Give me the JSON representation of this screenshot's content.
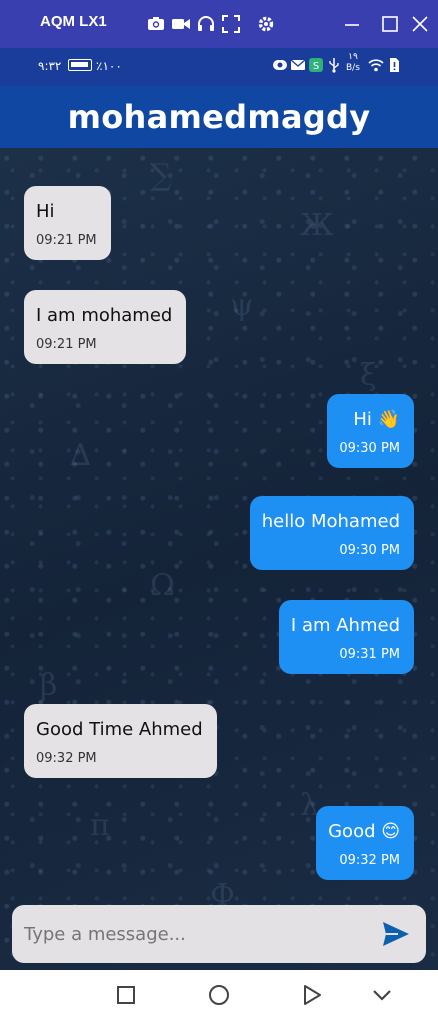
{
  "window": {
    "title": "AQM LX1",
    "icons": [
      "camera-icon",
      "video-icon",
      "headset-icon",
      "fullscreen-icon",
      "gear-icon"
    ],
    "controls": [
      "minimize-icon",
      "maximize-icon",
      "close-icon"
    ]
  },
  "status_bar": {
    "time": "٩:٣٢",
    "battery_pct": "٪١٠٠",
    "net_speed_value": "١٩",
    "net_speed_unit": "B/s"
  },
  "app_bar": {
    "title": "mohamedmagdy"
  },
  "messages": [
    {
      "direction": "received",
      "text": "Hi",
      "time": "09:21 PM"
    },
    {
      "direction": "received",
      "text": "I am mohamed",
      "time": "09:21 PM"
    },
    {
      "direction": "sent",
      "text": "Hi 👋",
      "time": "09:30 PM"
    },
    {
      "direction": "sent",
      "text": "hello Mohamed",
      "time": "09:30 PM"
    },
    {
      "direction": "sent",
      "text": "I am Ahmed",
      "time": "09:31 PM"
    },
    {
      "direction": "received",
      "text": "Good Time Ahmed",
      "time": "09:32 PM"
    },
    {
      "direction": "sent",
      "text": "Good 😊",
      "time": "09:32 PM"
    }
  ],
  "composer": {
    "placeholder": "Type a message...",
    "value": "",
    "send_icon": "send-icon"
  },
  "nav_bar": {
    "buttons": [
      "recents-icon",
      "home-icon",
      "back-icon",
      "collapse-icon"
    ]
  },
  "colors": {
    "window_titlebar": "#3a3fb0",
    "status_bar": "#1a3d9c",
    "app_bar": "#0f47a3",
    "sent_bubble": "#1e90f4",
    "received_bubble": "#e4e2e5",
    "send_icon": "#0d5fb0"
  }
}
